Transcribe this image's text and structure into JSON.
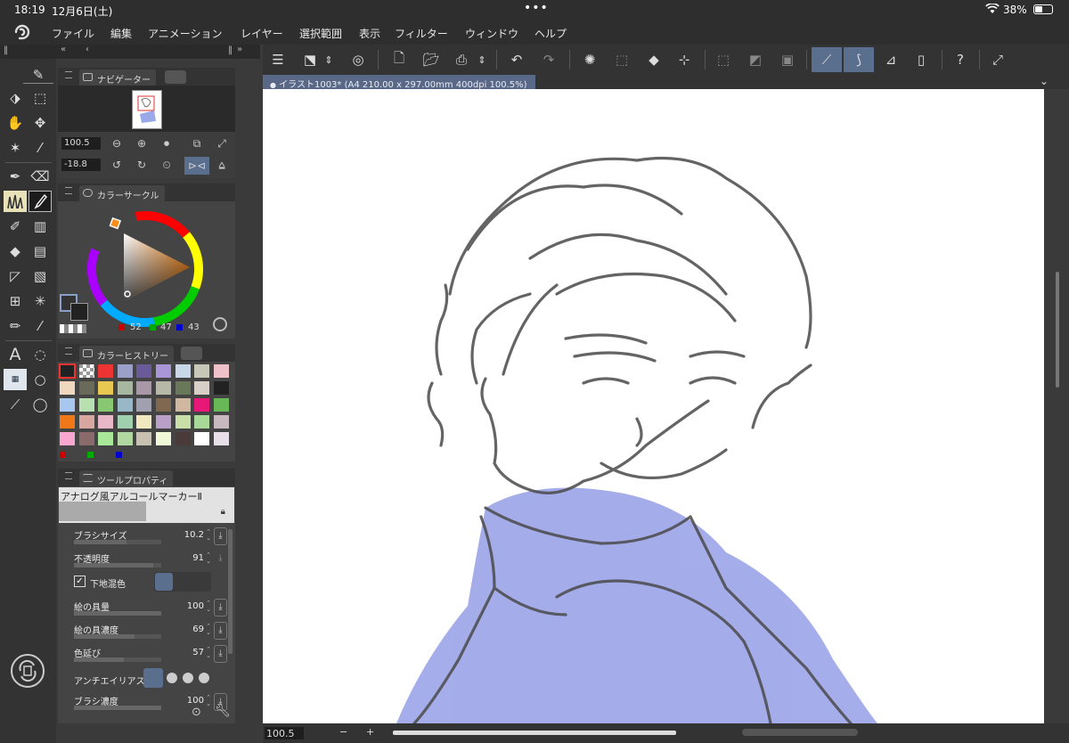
{
  "status": {
    "time": "18:19",
    "date": "12月6日(土)",
    "battery": "38%"
  },
  "menu": [
    "ファイル",
    "編集",
    "アニメーション",
    "レイヤー",
    "選択範囲",
    "表示",
    "フィルター",
    "ウィンドウ",
    "ヘルプ"
  ],
  "navigator": {
    "title": "ナビゲーター",
    "zoom": "100.5",
    "rotation": "-18.8"
  },
  "color_circle": {
    "title": "カラーサークル",
    "r": "52",
    "g": "47",
    "b": "43"
  },
  "color_history": {
    "title": "カラーヒストリー"
  },
  "tool_property": {
    "title": "ツールプロパティ",
    "brush_name": "アナログ風アルコールマーカーⅡ",
    "rows": [
      {
        "label": "ブラシサイズ",
        "value": "10.2",
        "fill": 0.6
      },
      {
        "label": "不透明度",
        "value": "91",
        "fill": 0.91
      },
      {
        "label": "下地混色",
        "value": "",
        "fill": 0
      },
      {
        "label": "絵の具量",
        "value": "100",
        "fill": 1.0
      },
      {
        "label": "絵の具濃度",
        "value": "69",
        "fill": 0.69
      },
      {
        "label": "色延び",
        "value": "57",
        "fill": 0.57
      },
      {
        "label": "アンチエイリアス",
        "value": "",
        "fill": 0
      },
      {
        "label": "ブラシ濃度",
        "value": "100",
        "fill": 1.0
      }
    ]
  },
  "document": {
    "tab_title": "イラスト1003* (A4 210.00 x 297.00mm 400dpi 100.5%)"
  },
  "bottom": {
    "zoom": "100.5",
    "minus": "−",
    "plus": "+"
  },
  "colors": {
    "accent": "#5a6e8e",
    "panel": "#444444",
    "stroke": "#4a4a4a",
    "blue_paint": "#5b6bd8"
  }
}
